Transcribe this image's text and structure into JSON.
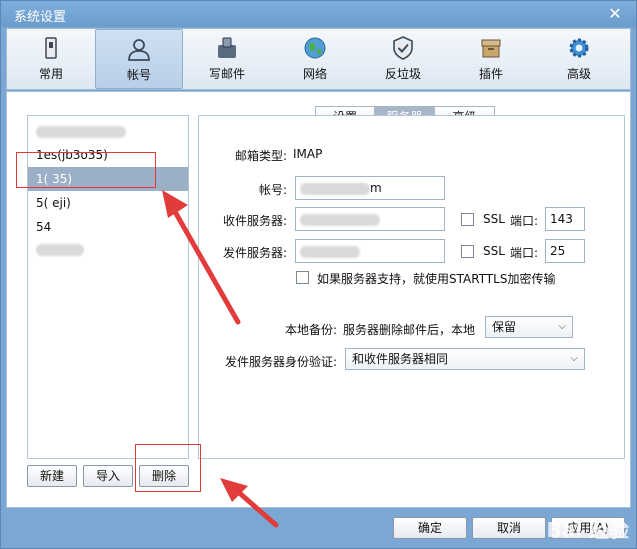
{
  "window": {
    "title": "系统设置",
    "close_glyph": "✕"
  },
  "toolbar": {
    "items": [
      {
        "label": "常用",
        "icon": "settings-panel-icon"
      },
      {
        "label": "帐号",
        "icon": "user-account-icon",
        "active": true
      },
      {
        "label": "写邮件",
        "icon": "write-mail-icon"
      },
      {
        "label": "网络",
        "icon": "globe-icon"
      },
      {
        "label": "反垃圾",
        "icon": "shield-check-icon"
      },
      {
        "label": "插件",
        "icon": "plugin-box-icon"
      },
      {
        "label": "高级",
        "icon": "gear-icon"
      }
    ]
  },
  "accounts": {
    "items": [
      {
        "text": "",
        "blurred": true
      },
      {
        "text": "1es(jb3o35)",
        "blurred": false
      },
      {
        "text": "1(       35)",
        "blurred": true,
        "selected": true
      },
      {
        "text": "5(       eji)",
        "blurred": true
      },
      {
        "text": "54",
        "blurred": true
      },
      {
        "text": "",
        "blurred": true
      }
    ],
    "buttons": {
      "new": "新建",
      "import": "导入",
      "delete": "删除"
    }
  },
  "tabs": {
    "settings": "设置",
    "server": "服务器",
    "advanced": "高级"
  },
  "server": {
    "mailbox_type_label": "邮箱类型:",
    "mailbox_type_value": "IMAP",
    "account_label": "帐号:",
    "account_value": "m",
    "incoming_label": "收件服务器:",
    "incoming_value": "",
    "outgoing_label": "发件服务器:",
    "outgoing_value": "",
    "ssl_label": "SSL",
    "port_label": "端口:",
    "incoming_port": "143",
    "outgoing_port": "25",
    "starttls_label": "如果服务器支持，就使用STARTTLS加密传输",
    "local_backup_label": "本地备份:",
    "local_backup_desc": "服务器删除邮件后，本地",
    "local_backup_value": "保留",
    "auth_label": "发件服务器身份验证:",
    "auth_value": "和收件服务器相同"
  },
  "dialog": {
    "ok": "确定",
    "cancel": "取消",
    "apply": "应用(A)"
  },
  "watermark": "Bai 经验"
}
